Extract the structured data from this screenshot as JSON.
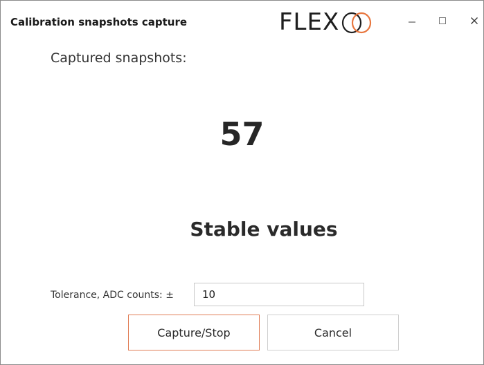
{
  "window": {
    "title": "Calibration snapshots capture",
    "logo_text": "FLEX",
    "accent_color": "#e8763e",
    "controls": {
      "minimize_icon": "minimize-icon",
      "maximize_icon": "maximize-icon",
      "close_icon": "close-icon"
    }
  },
  "main": {
    "captured_label": "Captured snapshots:",
    "captured_count": "57",
    "status_text": "Stable values"
  },
  "form": {
    "tolerance_label": "Tolerance, ADC counts: ±",
    "tolerance_value": "10"
  },
  "buttons": {
    "capture_label": "Capture/Stop",
    "cancel_label": "Cancel",
    "capture_border_color": "#e07b53"
  }
}
